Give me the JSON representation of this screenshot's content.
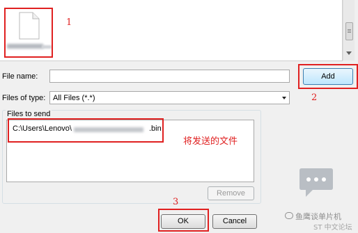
{
  "annotations": {
    "marker_1": "1",
    "marker_2": "2",
    "marker_3": "3",
    "note_files_to_send": "将发送的文件"
  },
  "browser": {
    "file_icon": "document-icon"
  },
  "form": {
    "file_name_label": "File name:",
    "file_name_value": "",
    "add_label": "Add",
    "files_of_type_label": "Files of type:",
    "files_of_type_value": "All Files (*.*)"
  },
  "files_to_send": {
    "group_label": "Files to send",
    "item_prefix": "C:\\Users\\Lenovo\\",
    "item_suffix": ".bin",
    "remove_label": "Remove"
  },
  "footer": {
    "ok_label": "OK",
    "cancel_label": "Cancel"
  },
  "watermark": {
    "name": "鱼鹰谈单片机",
    "site": "ST 中文论坛"
  },
  "colors": {
    "annotation_red": "#e02020",
    "focus_blue": "#3c7fb1"
  }
}
